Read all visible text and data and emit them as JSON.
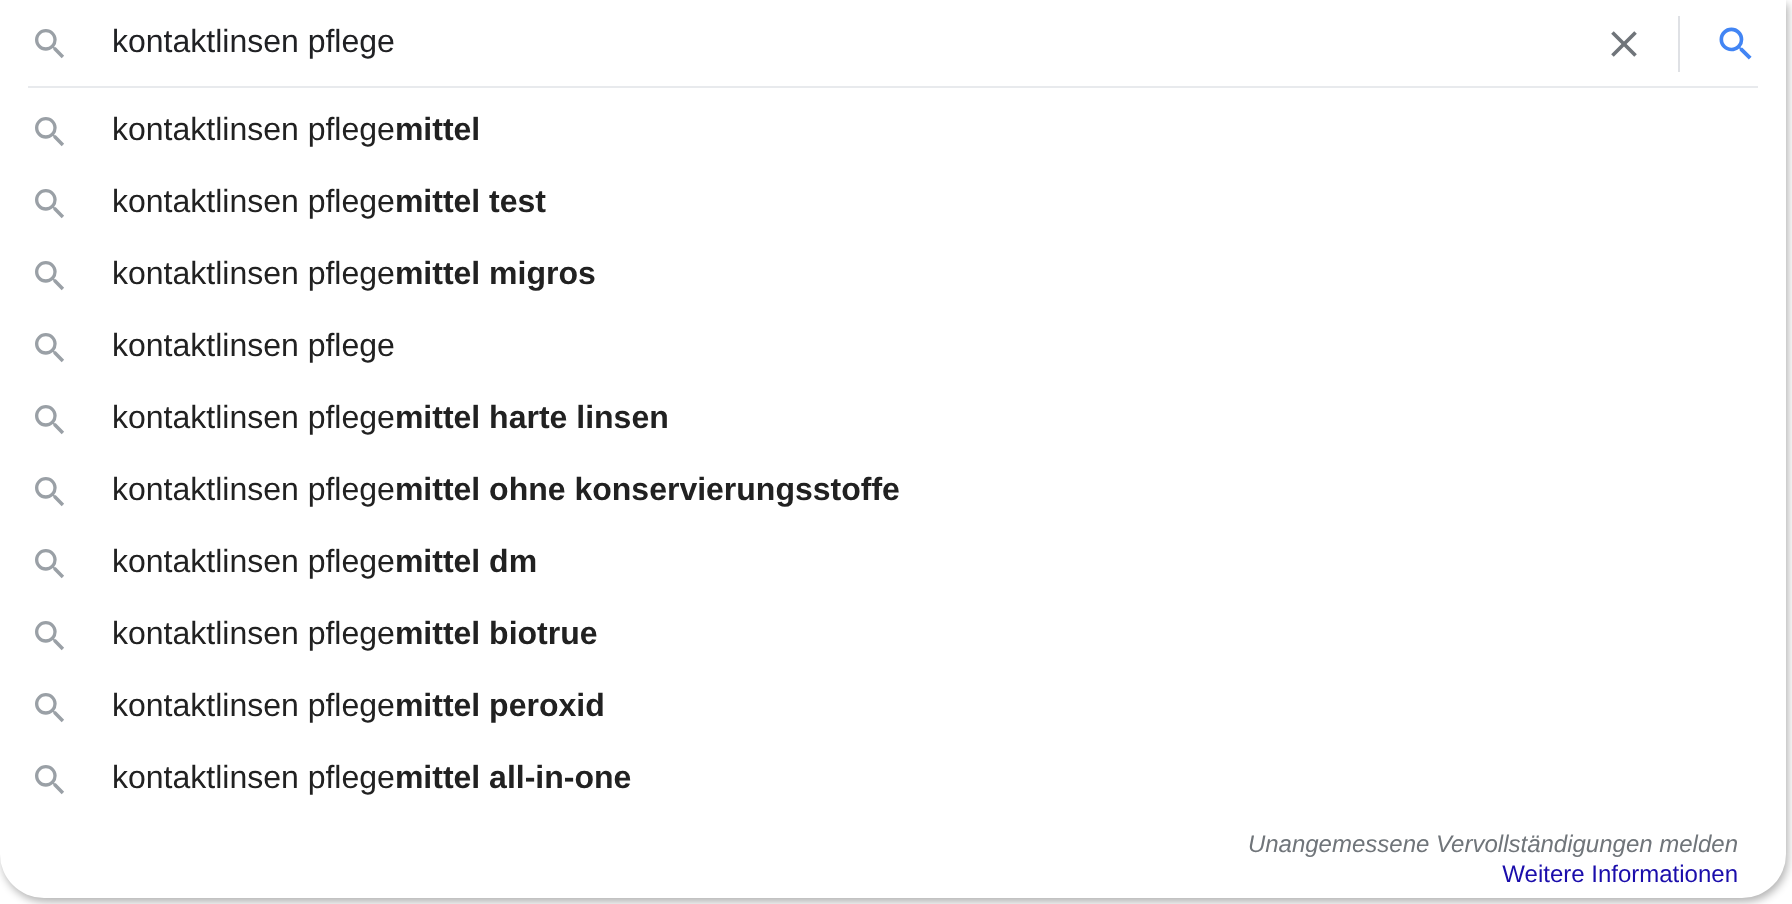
{
  "search": {
    "value": "kontaktlinsen pflege"
  },
  "suggestions": [
    "kontaktlinsen pflege**mittel**",
    "kontaktlinsen pflege**mittel test**",
    "kontaktlinsen pflege**mittel migros**",
    "kontaktlinsen pflege",
    "kontaktlinsen pflege**mittel harte linsen**",
    "kontaktlinsen pflege**mittel ohne konservierungsstoffe**",
    "kontaktlinsen pflege**mittel dm**",
    "kontaktlinsen pflege**mittel biotrue**",
    "kontaktlinsen pflege**mittel peroxid**",
    "kontaktlinsen pflege**mittel all-in-one**"
  ],
  "footer": {
    "report_link": "Unangemessene Vervollständigungen melden",
    "info_link": "Weitere Informationen"
  }
}
